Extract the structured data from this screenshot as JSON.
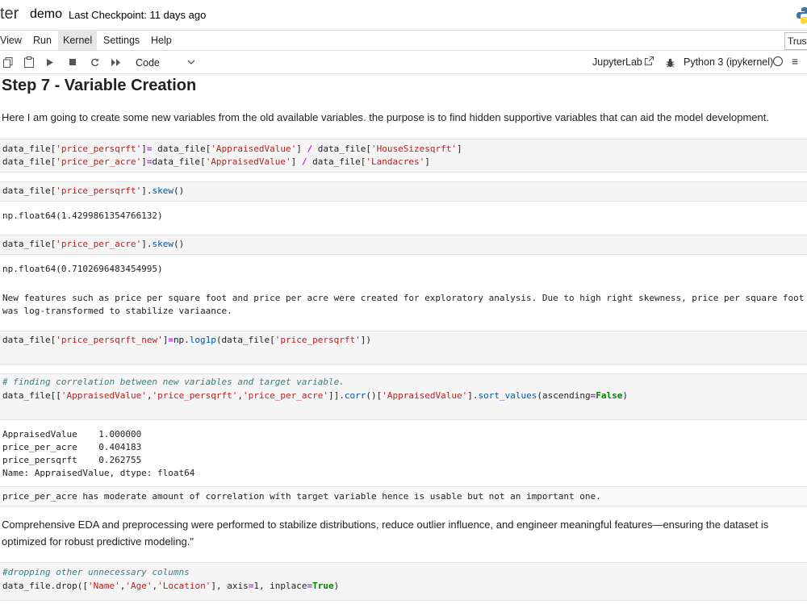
{
  "header": {
    "logo_fragment": "ter",
    "notebook_name": "demo",
    "checkpoint": "Last Checkpoint: 11 days ago"
  },
  "menu": {
    "items": [
      "View",
      "Run",
      "Kernel",
      "Settings",
      "Help"
    ],
    "active": "Kernel",
    "trust_label": "Trust"
  },
  "toolbar": {
    "cell_type": "Code",
    "jupyterlab_label": "JupyterLab",
    "kernel_name": "Python 3 (ipykernel)"
  },
  "cells": {
    "heading": "Step 7 - Variable Creation",
    "md1": "Here I am going to create some new variables from the old available variables. the purpose is to find hidden supportive variables that can aid the model development.",
    "c1l1": [
      "data_file[",
      "'price_persqrft'",
      "]",
      "=",
      " data_file[",
      "'AppraisedValue'",
      "] ",
      "/",
      " data_file[",
      "'HouseSizesqrft'",
      "]"
    ],
    "c1l2": [
      "data_file[",
      "'price_per_acre'",
      "]",
      "=",
      "data_file[",
      "'AppraisedValue'",
      "] ",
      "/",
      " data_file[",
      "'Landacres'",
      "]"
    ],
    "c2": [
      "data_file[",
      "'price_persqrft'",
      "].",
      "skew",
      "()"
    ],
    "o2": "np.float64(1.4299861354766132)",
    "c3": [
      "data_file[",
      "'price_per_acre'",
      "].",
      "skew",
      "()"
    ],
    "o3": "np.float64(0.7102696483454995)",
    "md2l1": "New features such as price per square foot and price per acre were created for exploratory analysis. Due to high right skewness, price per square foot",
    "md2l2": "was log-transformed to stabilize variaance.",
    "c4": [
      "data_file[",
      "'price_persqrft_new'",
      "]",
      "=",
      "np.",
      "log1p",
      "(data_file[",
      "'price_persqrft'",
      "])"
    ],
    "c5comment": "# finding correlation between new variables and target variable.",
    "c5": [
      "data_file[[",
      "'AppraisedValue'",
      ",",
      "'price_persqrft'",
      ",",
      "'price_per_acre'",
      "]].",
      "corr",
      "()[",
      "'AppraisedValue'",
      "].",
      "sort_values",
      "(ascending",
      "=",
      "False",
      ")"
    ],
    "o5": [
      "AppraisedValue    1.000000",
      "price_per_acre    0.404183",
      "price_persqrft    0.262755",
      "Name: AppraisedValue, dtype: float64"
    ],
    "md3": "price_per_acre has moderate amount of correlation with target variable hence is usable but not an important one.",
    "md4l1": "Comprehensive EDA and preprocessing were performed to stabilize distributions, reduce outlier influence, and engineer meaningful features—ensuring the dataset is",
    "md4l2": "optimized for robust predictive modeling.\"",
    "c6comment": "#dropping other unnecessary columns",
    "c6": [
      "data_file.drop([",
      "'Name'",
      ",",
      "'Age'",
      ",",
      "'Location'",
      "], axis",
      "=",
      "1",
      ", inplace",
      "=",
      "True",
      ")"
    ]
  }
}
